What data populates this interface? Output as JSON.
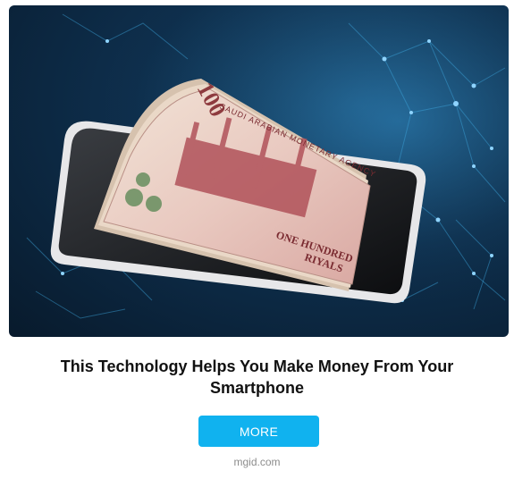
{
  "ad": {
    "image_alt": "Smartphone with a stack of Saudi banknotes",
    "banknote": {
      "denomination": "100",
      "issuer": "SAUDI ARABIAN MONETARY AGENCY",
      "amount_text_line1": "ONE HUNDRED",
      "amount_text_line2": "RIYALS"
    },
    "title": "This Technology Helps You Make Money From Your Smartphone",
    "button_label": "MORE",
    "source": "mgid.com"
  },
  "colors": {
    "button_bg": "#10b2ef",
    "title_text": "#111111",
    "source_text": "#8c8c8c",
    "hero_bg_dark": "#081a2c",
    "network_lines": "#3fa9e0"
  }
}
